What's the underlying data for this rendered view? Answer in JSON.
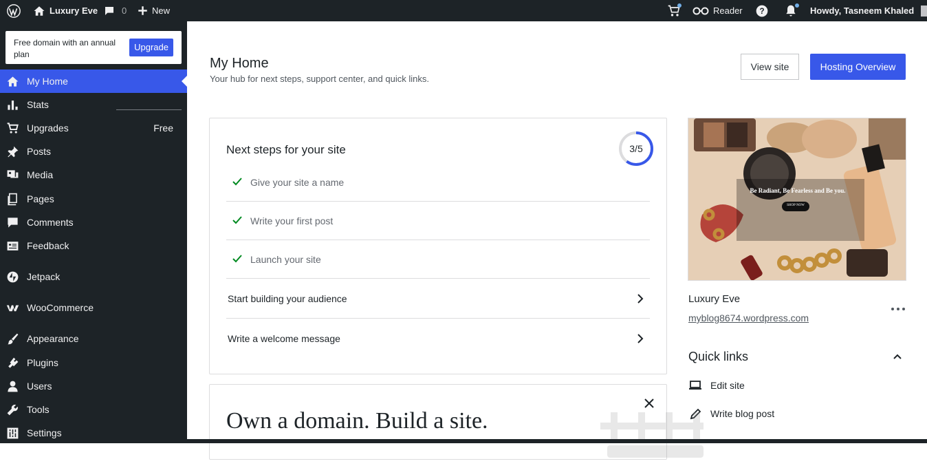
{
  "adminbar": {
    "site_name": "Luxury Eve",
    "comments_count": "0",
    "new_label": "New",
    "reader_label": "Reader",
    "howdy": "Howdy, Tasneem Khaled"
  },
  "promo": {
    "text": "Free domain with an annual plan",
    "button": "Upgrade"
  },
  "sidebar": {
    "items": [
      {
        "label": "My Home",
        "icon": "home-icon",
        "active": true
      },
      {
        "label": "Stats",
        "icon": "stats-icon"
      },
      {
        "label": "Upgrades",
        "icon": "cart-icon",
        "extra": "Free"
      },
      {
        "label": "Posts",
        "icon": "pin-icon"
      },
      {
        "label": "Media",
        "icon": "media-icon"
      },
      {
        "label": "Pages",
        "icon": "pages-icon"
      },
      {
        "label": "Comments",
        "icon": "comment-icon"
      },
      {
        "label": "Feedback",
        "icon": "feedback-icon"
      },
      {
        "label": "Jetpack",
        "icon": "jetpack-icon"
      },
      {
        "label": "WooCommerce",
        "icon": "woocommerce-icon"
      },
      {
        "label": "Appearance",
        "icon": "brush-icon"
      },
      {
        "label": "Plugins",
        "icon": "plugin-icon"
      },
      {
        "label": "Users",
        "icon": "user-icon"
      },
      {
        "label": "Tools",
        "icon": "wrench-icon"
      },
      {
        "label": "Settings",
        "icon": "settings-icon"
      }
    ]
  },
  "header": {
    "title": "My Home",
    "subtitle": "Your hub for next steps, support center, and quick links.",
    "view_site": "View site",
    "hosting_overview": "Hosting Overview"
  },
  "next_steps": {
    "title": "Next steps for your site",
    "progress": "3/5",
    "progress_fraction": 0.6,
    "completed": [
      "Give your site a name",
      "Write your first post",
      "Launch your site"
    ],
    "todo": [
      "Start building your audience",
      "Write a welcome message"
    ]
  },
  "domain_card": {
    "heading": "Own a domain. Build a site."
  },
  "site": {
    "name": "Luxury Eve",
    "url": "myblog8674.wordpress.com",
    "thumb_tagline": "Be Radiant, Be Fearless and Be you.",
    "thumb_button": "SHOP NOW"
  },
  "quick_links": {
    "title": "Quick links",
    "items": [
      {
        "label": "Edit site",
        "icon": "laptop-icon"
      },
      {
        "label": "Write blog post",
        "icon": "pencil-icon"
      }
    ]
  },
  "colors": {
    "accent": "#3858e9",
    "sidebar_bg": "#1d2327",
    "check": "#008a20"
  }
}
